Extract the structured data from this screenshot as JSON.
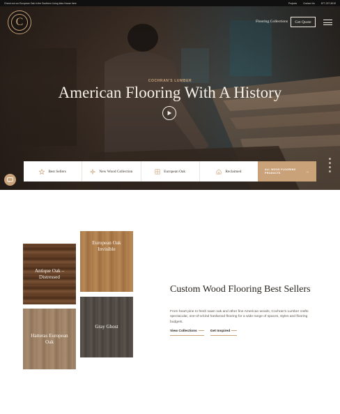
{
  "topbar": {
    "message": "Check out our European Oak in the Southern Living Idea House here",
    "links": [
      "Projects",
      "Contact Us",
      "877-237-8019"
    ]
  },
  "header": {
    "logo_letter": "C",
    "nav_link": "Flooring Collections",
    "quote_button": "Get Quote",
    "menu_icon": "hamburger-icon"
  },
  "hero": {
    "eyebrow": "COCHRAN'S LUMBER",
    "title": "American Flooring With A History",
    "play_icon": "play-icon"
  },
  "categories": [
    {
      "label": "Best Sellers",
      "icon": "star-icon"
    },
    {
      "label": "New Wood Collection",
      "icon": "sparkle-icon"
    },
    {
      "label": "European Oak",
      "icon": "grid-icon"
    },
    {
      "label": "Reclaimed",
      "icon": "barn-icon"
    }
  ],
  "all_products": {
    "line1": "ALL WOOD FLOORING",
    "line2": "PRODUCTS",
    "arrow": "→"
  },
  "tiles": [
    {
      "label": "Antique Oak – Distressed"
    },
    {
      "label": "European Oak Invisible"
    },
    {
      "label": "Hatteras European Oak"
    },
    {
      "label": "Gray Ghost"
    }
  ],
  "feature": {
    "title": "Custom Wood Flooring Best Sellers",
    "body": "From heart pine to fresh sawn oak and other fine American woods, Cochran's Lumber crafts spectacular, one-of-a-kind hardwood flooring for a wide range of spaces, styles and flooring budgets.",
    "link1": "View Collections",
    "link2": "Get Inspired"
  },
  "colors": {
    "accent": "#c9a27a",
    "dark": "#111010",
    "text": "#2a2520"
  }
}
